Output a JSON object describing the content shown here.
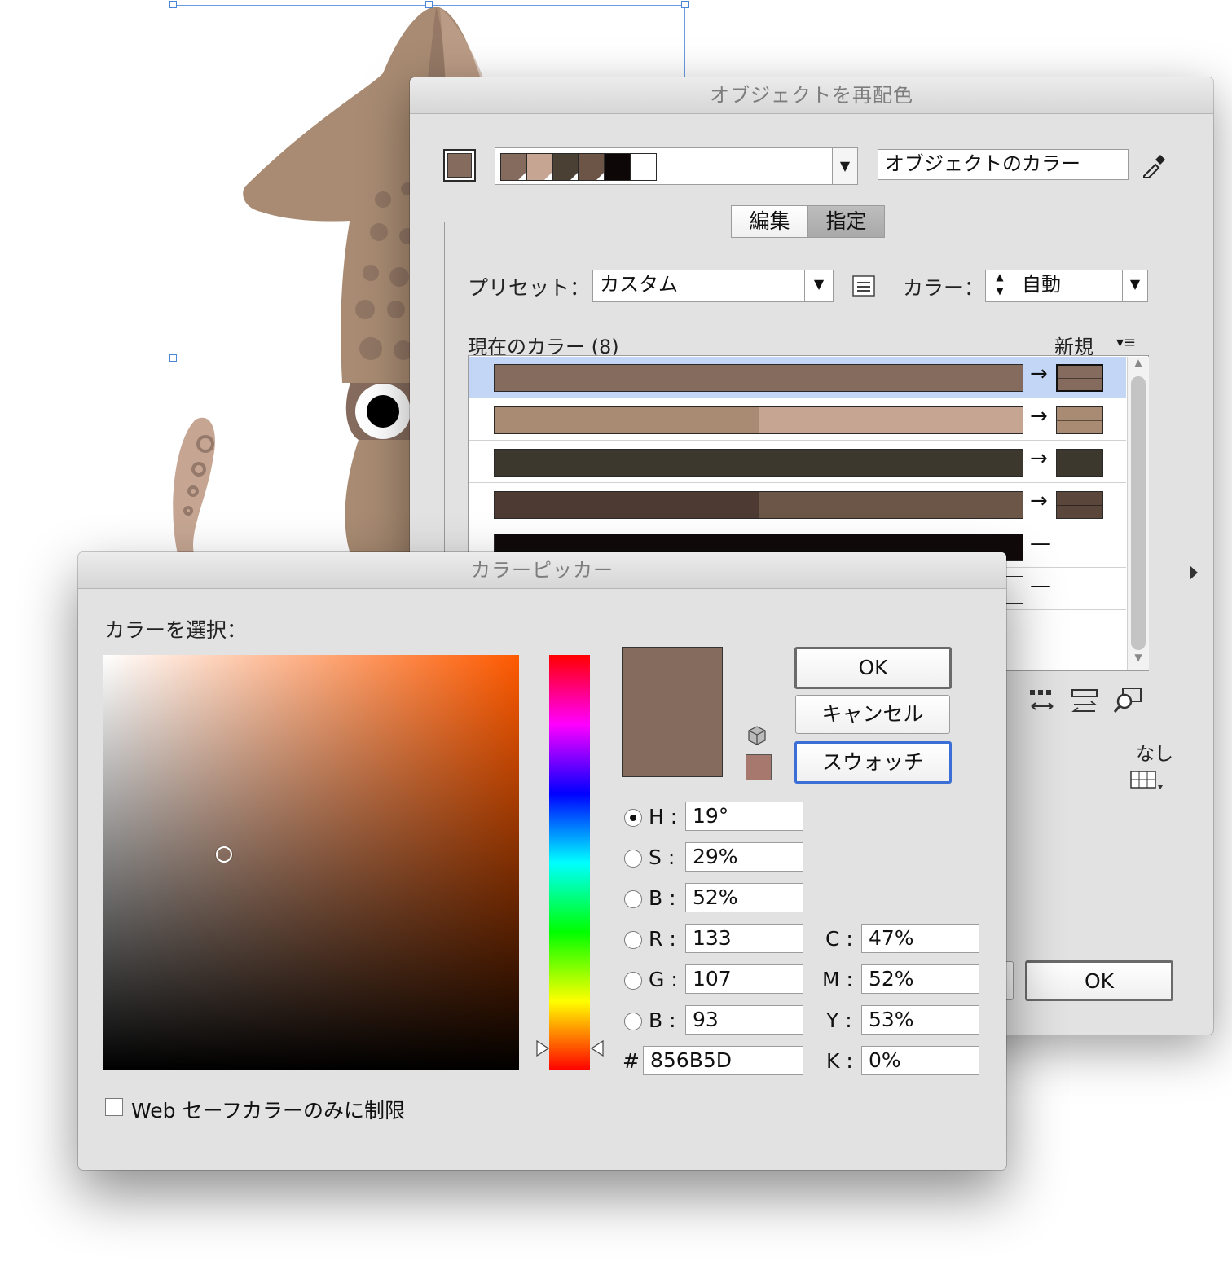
{
  "recolor_dialog": {
    "title": "オブジェクトを再配色",
    "color_group_name": "オブジェクトのカラー",
    "tabs": [
      {
        "label": "編集",
        "active": false
      },
      {
        "label": "指定",
        "active": true
      }
    ],
    "preset_label": "プリセット：",
    "preset_value": "カスタム",
    "colors_label": "カラー：",
    "colors_value": "自動",
    "current_colors_label": "現在のカラー (8)",
    "new_label": "新規",
    "none_label": "なし",
    "ok_label": "OK",
    "swatch_strip": [
      "#856b5d",
      "#c6a693",
      "#4a4033",
      "#6c5446",
      "#0d0807",
      "#ffffff"
    ],
    "rows": [
      {
        "current": [
          "#856b5d"
        ],
        "new": "#856b5d",
        "mapped": true,
        "selected": true
      },
      {
        "current": [
          "#a88b72",
          "#c6a693"
        ],
        "new": "#a88b72",
        "mapped": true,
        "selected": false
      },
      {
        "current": [
          "#3c382e"
        ],
        "new": "#3c382e",
        "mapped": true,
        "selected": false
      },
      {
        "current": [
          "#4d3a32",
          "#6b5648"
        ],
        "new": "#5a463b",
        "mapped": true,
        "selected": false
      },
      {
        "current": [
          "#100b0a"
        ],
        "new": null,
        "mapped": false,
        "selected": false
      },
      {
        "current": [
          "#ffffff"
        ],
        "new": null,
        "mapped": false,
        "selected": false
      }
    ]
  },
  "color_picker": {
    "title": "カラーピッカー",
    "select_color_label": "カラーを選択：",
    "ok_label": "OK",
    "cancel_label": "キャンセル",
    "swatches_label": "スウォッチ",
    "web_safe_label": "Web セーフカラーのみに制限",
    "web_safe_checked": false,
    "selected_color": "#856B5D",
    "warning_color": "#a7786e",
    "hue_slider_fraction": 0.053,
    "sb_marker": {
      "saturation": 0.29,
      "brightness": 0.52
    },
    "fields": {
      "H": "19°",
      "S": "29%",
      "B_hsb": "52%",
      "R": "133",
      "G": "107",
      "B_rgb": "93",
      "hex": "856B5D",
      "C": "47%",
      "M": "52%",
      "Y": "53%",
      "K": "0%"
    },
    "labels": {
      "H": "H :",
      "S": "S :",
      "B_hsb": "B :",
      "R": "R :",
      "G": "G :",
      "B_rgb": "B :",
      "hash": "#",
      "C": "C :",
      "M": "M :",
      "Y": "Y :",
      "K": "K :"
    },
    "active_channel": "H"
  },
  "colors": {
    "squid_body": "#a88b72",
    "squid_light": "#c6a693",
    "squid_dark": "#856b5d",
    "selection": "#4a86d8"
  }
}
